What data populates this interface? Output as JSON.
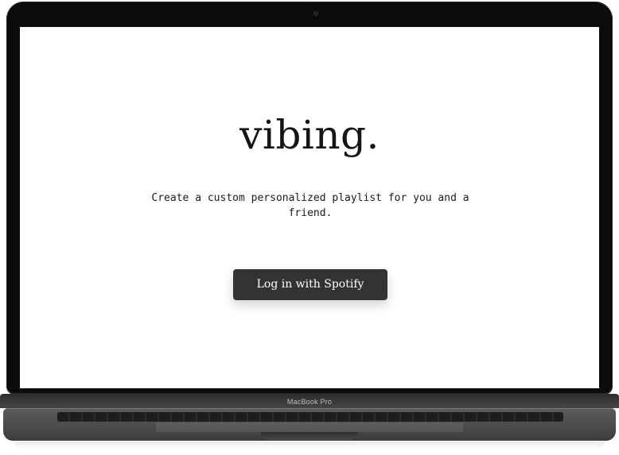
{
  "device": {
    "brand_label": "MacBook Pro"
  },
  "app": {
    "title": "vibing.",
    "tagline": "Create a custom personalized playlist for you and a friend.",
    "primary_button_label": "Log in with Spotify"
  },
  "colors": {
    "bezel": "#0b0b0b",
    "screen_bg": "#ffffff",
    "title_text": "#151515",
    "button_bg": "#333333",
    "button_text": "#ffffff"
  },
  "icons": {
    "camera": "webcam-icon"
  }
}
